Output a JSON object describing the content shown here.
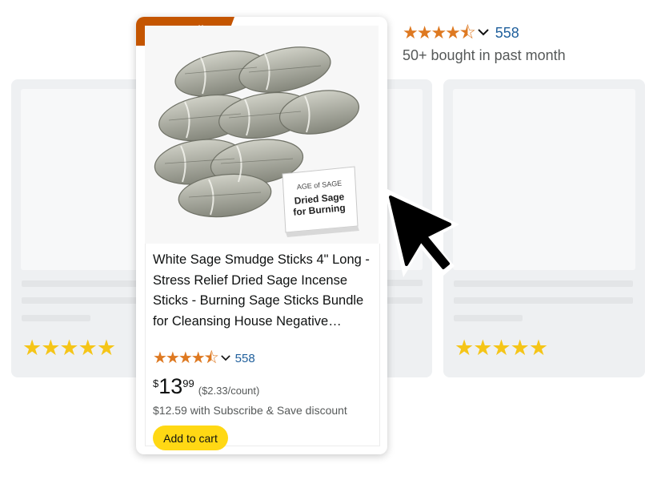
{
  "badge": "Best Seller",
  "product": {
    "title": "White Sage Smudge Sticks 4\" Long - Stress Relief Dried Sage Incense Sticks - Burning Sage Sticks Bundle for Cleansing House Negative…",
    "stars": "★★★★⯪",
    "rating_count": "558",
    "price_currency": "$",
    "price_whole": "13",
    "price_fraction": "99",
    "unit_price": "($2.33/count)",
    "subscribe_text": "$12.59 with Subscribe & Save discount",
    "add_to_cart": "Add to cart",
    "package_brand": "AGE of SAGE",
    "package_line1": "Dried Sage",
    "package_line2": "for Burning"
  },
  "background_card": {
    "stars": "★★★★★"
  },
  "top_block": {
    "stars": "★★★★⯪",
    "rating_count": "558",
    "bought": "50+ bought in past month"
  },
  "colors": {
    "badge": "#c45500",
    "orange_stars": "#de7921",
    "gold_stars": "#f5c518",
    "link": "#1f5f9c",
    "cart_button": "#ffd814"
  },
  "icons": [
    "chevron-down-icon",
    "mouse-cursor-icon"
  ]
}
